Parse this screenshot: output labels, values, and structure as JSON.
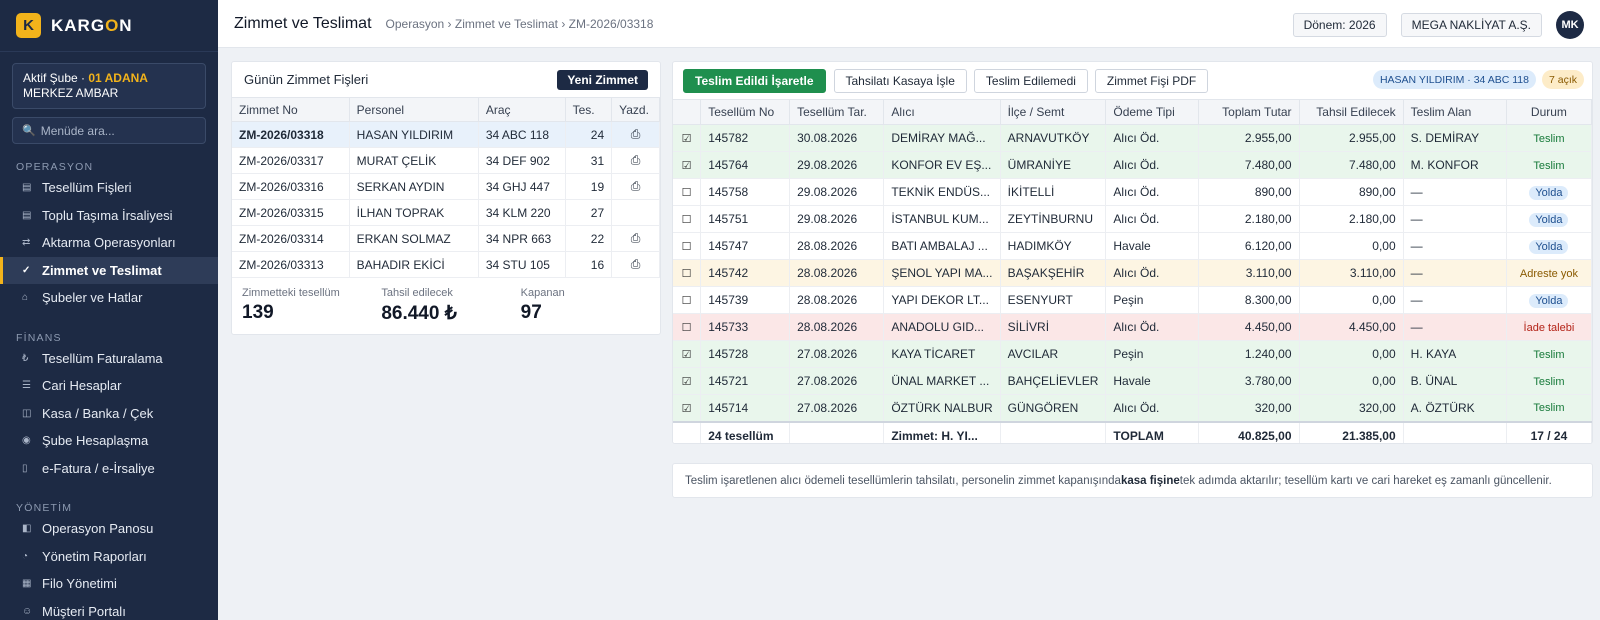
{
  "brand": {
    "mark": "K",
    "name_a": "KARG",
    "name_b": "O",
    "name_c": "N"
  },
  "branch": {
    "prefix": "Aktif Şube · ",
    "code": "01 ADANA",
    "suffix": " MERKEZ AMBAR"
  },
  "search": {
    "icon": "search-icon",
    "placeholder": "Menüde ara..."
  },
  "sidebar": {
    "sections": [
      {
        "title": "OPERASYON",
        "items": [
          {
            "label": "Tesellüm Fişleri",
            "icon": "list-icon"
          },
          {
            "label": "Toplu Taşıma İrsaliyesi",
            "icon": "list-icon"
          },
          {
            "label": "Aktarma Operasyonları",
            "icon": "transfer-icon"
          },
          {
            "label": "Zimmet ve Teslimat",
            "icon": "check-icon",
            "active": true
          },
          {
            "label": "Şubeler ve Hatlar",
            "icon": "home-icon"
          }
        ]
      },
      {
        "title": "FİNANS",
        "items": [
          {
            "label": "Tesellüm Faturalama",
            "icon": "lira-icon"
          },
          {
            "label": "Cari Hesaplar",
            "icon": "menu-icon"
          },
          {
            "label": "Kasa / Banka / Çek",
            "icon": "cash-icon"
          },
          {
            "label": "Şube Hesaplaşma",
            "icon": "binoculars-icon"
          },
          {
            "label": "e-Fatura / e-İrsaliye",
            "icon": "document-icon"
          }
        ]
      },
      {
        "title": "YÖNETİM",
        "items": [
          {
            "label": "Operasyon Panosu",
            "icon": "dashboard-icon"
          },
          {
            "label": "Yönetim Raporları",
            "icon": "pie-icon"
          },
          {
            "label": "Filo Yönetimi",
            "icon": "truck-icon"
          },
          {
            "label": "Müşteri Portalı",
            "icon": "user-icon"
          }
        ]
      }
    ]
  },
  "header": {
    "title": "Zimmet ve Teslimat",
    "breadcrumb": "Operasyon › Zimmet ve Teslimat › ZM-2026/03318",
    "period": "Dönem: 2026",
    "company": "MEGA NAKLİYAT A.Ş.",
    "avatar": "MK"
  },
  "left": {
    "title": "Günün Zimmet Fişleri",
    "new_button": "Yeni Zimmet",
    "columns": [
      "Zimmet No",
      "Personel",
      "Araç",
      "Tes.",
      "Yazd."
    ],
    "rows": [
      {
        "no": "ZM-2026/03318",
        "personel": "HASAN YILDIRIM",
        "arac": "34 ABC 118",
        "tes": "24",
        "printed": true,
        "selected": true
      },
      {
        "no": "ZM-2026/03317",
        "personel": "MURAT ÇELİK",
        "arac": "34 DEF 902",
        "tes": "31",
        "printed": true
      },
      {
        "no": "ZM-2026/03316",
        "personel": "SERKAN AYDIN",
        "arac": "34 GHJ 447",
        "tes": "19",
        "printed": true
      },
      {
        "no": "ZM-2026/03315",
        "personel": "İLHAN TOPRAK",
        "arac": "34 KLM 220",
        "tes": "27",
        "printed": false
      },
      {
        "no": "ZM-2026/03314",
        "personel": "ERKAN SOLMAZ",
        "arac": "34 NPR 663",
        "tes": "22",
        "printed": true
      },
      {
        "no": "ZM-2026/03313",
        "personel": "BAHADIR EKİCİ",
        "arac": "34 STU 105",
        "tes": "16",
        "printed": true
      }
    ],
    "printed_icon": "printer-icon",
    "stats": [
      {
        "label": "Zimmetteki tesellüm",
        "value": "139"
      },
      {
        "label": "Tahsil edilecek",
        "value": "86.440 ₺"
      },
      {
        "label": "Kapanan",
        "value": "97"
      }
    ]
  },
  "right": {
    "buttons": [
      "Teslim Edildi İşaretle",
      "Tahsilatı Kasaya İşle",
      "Teslim Edilemedi",
      "Zimmet Fişi PDF"
    ],
    "tag_person": "HASAN YILDIRIM · 34 ABC 118",
    "tag_open": "7 açık",
    "columns": [
      "",
      "Tesellüm No",
      "Tesellüm Tar.",
      "Alıcı",
      "İlçe / Semt",
      "Ödeme Tipi",
      "Toplam Tutar",
      "Tahsil Edilecek",
      "Teslim Alan",
      "Durum"
    ],
    "rows": [
      {
        "check": "☑",
        "no": "145782",
        "tarih": "30.08.2026",
        "alici": "DEMİRAY MAĞ...",
        "ilce": "ARNAVUTKÖY",
        "odeme": "Alıcı Öd.",
        "toplam": "2.955,00",
        "tahsil": "2.955,00",
        "alan": "S. DEMİRAY",
        "durum": "Teslim",
        "state": "g"
      },
      {
        "check": "☑",
        "no": "145764",
        "tarih": "29.08.2026",
        "alici": "KONFOR EV EŞ...",
        "ilce": "ÜMRANİYE",
        "odeme": "Alıcı Öd.",
        "toplam": "7.480,00",
        "tahsil": "7.480,00",
        "alan": "M. KONFOR",
        "durum": "Teslim",
        "state": "g"
      },
      {
        "check": "☐",
        "no": "145758",
        "tarih": "29.08.2026",
        "alici": "TEKNİK ENDÜS...",
        "ilce": "İKİTELLİ",
        "odeme": "Alıcı Öd.",
        "toplam": "890,00",
        "tahsil": "890,00",
        "alan": "—",
        "durum": "Yolda",
        "state": "w"
      },
      {
        "check": "☐",
        "no": "145751",
        "tarih": "29.08.2026",
        "alici": "İSTANBUL KUM...",
        "ilce": "ZEYTİNBURNU",
        "odeme": "Alıcı Öd.",
        "toplam": "2.180,00",
        "tahsil": "2.180,00",
        "alan": "—",
        "durum": "Yolda",
        "state": "w"
      },
      {
        "check": "☐",
        "no": "145747",
        "tarih": "28.08.2026",
        "alici": "BATI AMBALAJ ...",
        "ilce": "HADIMKÖY",
        "odeme": "Havale",
        "toplam": "6.120,00",
        "tahsil": "0,00",
        "alan": "—",
        "durum": "Yolda",
        "state": "w"
      },
      {
        "check": "☐",
        "no": "145742",
        "tarih": "28.08.2026",
        "alici": "ŞENOL YAPI MA...",
        "ilce": "BAŞAKŞEHİR",
        "odeme": "Alıcı Öd.",
        "toplam": "3.110,00",
        "tahsil": "3.110,00",
        "alan": "—",
        "durum": "Adreste yok",
        "state": "y"
      },
      {
        "check": "☐",
        "no": "145739",
        "tarih": "28.08.2026",
        "alici": "YAPI DEKOR LT...",
        "ilce": "ESENYURT",
        "odeme": "Peşin",
        "toplam": "8.300,00",
        "tahsil": "0,00",
        "alan": "—",
        "durum": "Yolda",
        "state": "w"
      },
      {
        "check": "☐",
        "no": "145733",
        "tarih": "28.08.2026",
        "alici": "ANADOLU GID...",
        "ilce": "SİLİVRİ",
        "odeme": "Alıcı Öd.",
        "toplam": "4.450,00",
        "tahsil": "4.450,00",
        "alan": "—",
        "durum": "İade talebi",
        "state": "r"
      },
      {
        "check": "☑",
        "no": "145728",
        "tarih": "27.08.2026",
        "alici": "KAYA TİCARET",
        "ilce": "AVCILAR",
        "odeme": "Peşin",
        "toplam": "1.240,00",
        "tahsil": "0,00",
        "alan": "H. KAYA",
        "durum": "Teslim",
        "state": "g"
      },
      {
        "check": "☑",
        "no": "145721",
        "tarih": "27.08.2026",
        "alici": "ÜNAL MARKET ...",
        "ilce": "BAHÇELİEVLER",
        "odeme": "Havale",
        "toplam": "3.780,00",
        "tahsil": "0,00",
        "alan": "B. ÜNAL",
        "durum": "Teslim",
        "state": "g"
      },
      {
        "check": "☑",
        "no": "145714",
        "tarih": "27.08.2026",
        "alici": "ÖZTÜRK NALBUR",
        "ilce": "GÜNGÖREN",
        "odeme": "Alıcı Öd.",
        "toplam": "320,00",
        "tahsil": "320,00",
        "alan": "A. ÖZTÜRK",
        "durum": "Teslim",
        "state": "g"
      }
    ],
    "totals": {
      "count": "24 tesellüm",
      "zimmet": "Zimmet: H. YI...",
      "label": "TOPLAM",
      "toplam": "40.825,00",
      "tahsil": "21.385,00",
      "durum": "17 / 24"
    }
  },
  "note": {
    "before": "Teslim işaretlenen alıcı ödemeli tesellümlerin tahsilatı, personelin zimmet kapanışında ",
    "bold": "kasa fişine",
    "after": " tek adımda aktarılır; tesellüm kartı ve cari hareket eş zamanlı güncellenir."
  },
  "colors": {
    "sidebar": "#1d2a44",
    "accent": "#f2b31b",
    "primary_green": "#1f8f4e",
    "delivered_row": "#e9f6ec",
    "absent_row": "#fdf5e3",
    "return_row": "#fbe7e7"
  }
}
